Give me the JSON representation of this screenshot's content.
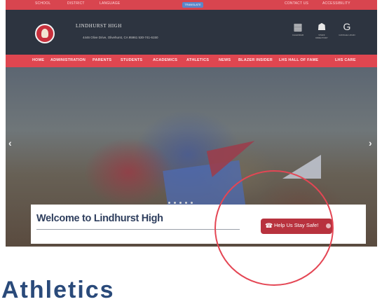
{
  "util_bar": {
    "left_links": [
      "SCHOOL",
      "DISTRICT",
      "LANGUAGE"
    ],
    "translate": "TRANSLATE",
    "right_links": "CONTACT US",
    "right_links2": "ACCESSIBILITY"
  },
  "header": {
    "school_name": "LINDHURST HIGH",
    "address": "4446 Olive Drive, Olivehurst, CA 95961    530-741-6150",
    "icons": [
      {
        "label": "CALENDAR",
        "icon": "calendar-icon",
        "glyph": "▦"
      },
      {
        "label": "STAFF DIRECTORY",
        "icon": "staff-icon",
        "glyph": "☗"
      },
      {
        "label": "GOOGLE LOGIN",
        "icon": "google-icon",
        "glyph": "G"
      }
    ]
  },
  "nav": {
    "items": [
      "HOME",
      "ADMINISTRATION",
      "PARENTS",
      "STUDENTS",
      "ACADEMICS",
      "ATHLETICS",
      "NEWS",
      "BLAZER INSIDER",
      "LHS HALL OF FAME",
      "LHS CARE"
    ]
  },
  "hero": {
    "prev_arrow": "‹",
    "next_arrow": "›"
  },
  "card": {
    "welcome": "Welcome to Lindhurst High",
    "safe_button": "Help Us Stay Safe!",
    "safe_icon": "☎"
  },
  "page_heading": "Athletics",
  "colors": {
    "accent": "#df4650",
    "header": "#2d3440",
    "heading": "#2a4a7a",
    "button": "#b8323e"
  }
}
